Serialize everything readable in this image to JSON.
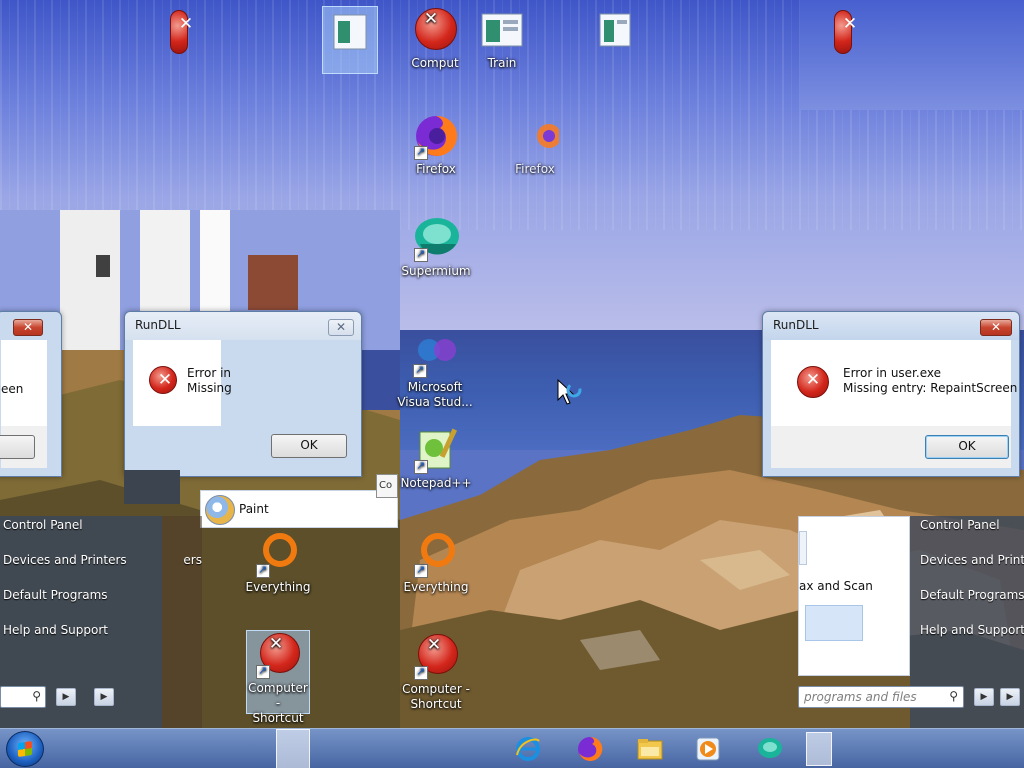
{
  "desktop": {
    "icons": {
      "computer_top": "Comput",
      "train": "Train",
      "firefox": "Firefox",
      "firefox_ghost": "Firefox",
      "supermium": "Supermium",
      "vs_line1": "Microsoft",
      "vs_line2": "Visua Stud...",
      "notepad": "Notepad++",
      "everything": "Everything",
      "everything_ghost": "Everything",
      "computer_shortcut_1": "Computer -",
      "computer_shortcut_2": "Shortcut",
      "computer_shortcut_ghost_1": "Computer -",
      "computer_shortcut_ghost_2": "Shortcut"
    }
  },
  "dialogs": {
    "main": {
      "title": "RunDLL",
      "close": "✕",
      "line1": "Error in user.exe",
      "line2": "Missing entry: RepaintScreen",
      "ok": "OK"
    },
    "ghost": {
      "title": "RunDLL",
      "close": "✕",
      "line1": "Error in",
      "line2": "Missing",
      "ok": "OK"
    },
    "left_fragment": {
      "close": "✕",
      "text": "een"
    }
  },
  "paint_item": {
    "label": "Paint"
  },
  "start_menu": {
    "control_panel": "Control Panel",
    "devices": "Devices and Printers",
    "default_programs": "Default Programs",
    "help": "Help and Support",
    "fax_scan": "ax and Scan",
    "search_placeholder": "programs and files",
    "right_fragment_ers": "ers"
  },
  "tooltip_fragment": "Co",
  "colors": {
    "taskbar": "#4a6aa8",
    "dialog_frame": "#c9d9ee",
    "error_red": "#d3261b"
  },
  "icon_names": [
    "error-icon",
    "window-icon",
    "firefox-icon",
    "supermium-icon",
    "visual-studio-icon",
    "notepadpp-icon",
    "everything-icon",
    "ie-icon",
    "folder-icon",
    "media-player-icon"
  ]
}
